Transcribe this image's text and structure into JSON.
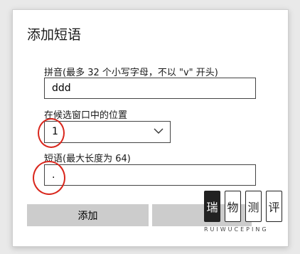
{
  "dialog": {
    "title": "添加短语",
    "pinyin": {
      "label": "拼音(最多 32 个小写字母，不以 \"v\" 开头)",
      "value": "ddd"
    },
    "position": {
      "label": "在候选窗口中的位置",
      "value": "1"
    },
    "phrase": {
      "label": "短语(最大长度为 64)",
      "value": "."
    },
    "buttons": {
      "add": "添加",
      "cancel": ""
    }
  },
  "watermark": {
    "chars": [
      "瑞",
      "物",
      "测",
      "评"
    ],
    "latin": "RUIWUCEPING"
  },
  "colors": {
    "annotation": "#d9261c",
    "button": "#cccccc"
  }
}
